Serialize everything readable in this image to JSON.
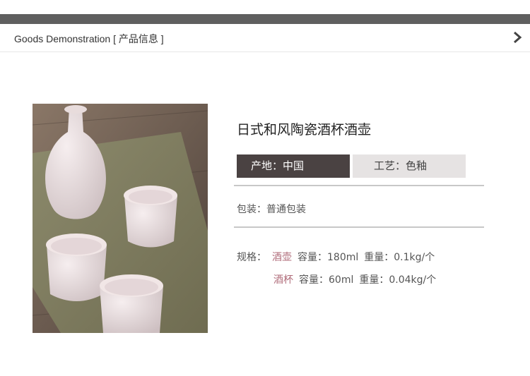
{
  "header": {
    "title": "Goods Demonstration [ 产品信息 ]",
    "arrow_icon": "chevron-right-icon"
  },
  "product": {
    "image_description": "photo-sake-set",
    "name": "日式和风陶瓷酒杯酒壶",
    "tags": [
      {
        "label": "产地：中国",
        "color": "#4a4242"
      },
      {
        "label": "工艺：色釉",
        "color": "#e6e3e3"
      }
    ],
    "packaging": "包装：普通包装",
    "specs": {
      "label": "规格：",
      "items": [
        {
          "name": "酒壶",
          "capacity": "容量：180ml",
          "weight": "重量：0.1kg/个"
        },
        {
          "name": "酒杯",
          "capacity": "容量：60ml",
          "weight": "重量：0.04kg/个"
        }
      ]
    }
  },
  "colors": {
    "accent": "#b06c7a",
    "dark_bar": "#5f5f5f",
    "divider": "#c8c8c8"
  }
}
